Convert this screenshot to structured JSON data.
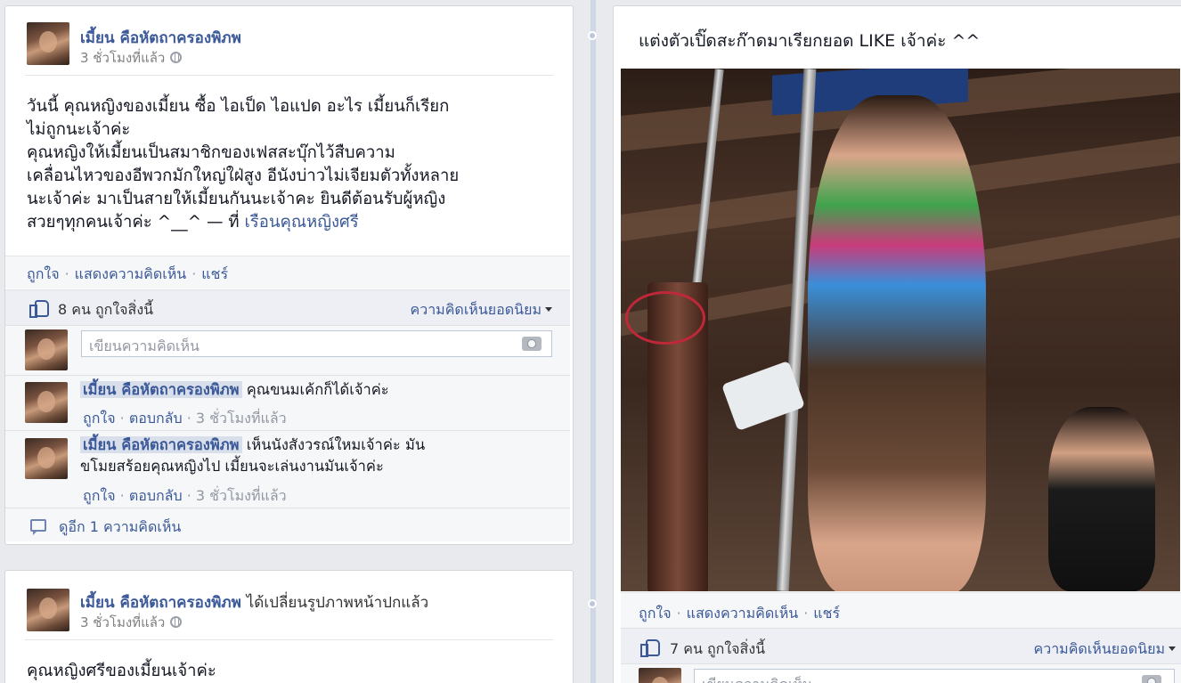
{
  "left_post_1": {
    "author": "เมี้ยน คือหัตถาครองพิภพ",
    "timestamp": "3 ชั่วโมงที่แล้ว",
    "text_lines": [
      "วันนี้ คุณหญิงของเมี้ยน ซื้อ ไอเป็ด ไอแปด อะไร เมี้ยนก็เรียก",
      "ไม่ถูกนะเจ้าค่ะ",
      "คุณหญิงให้เมี้ยนเป็นสมาชิกของเฟสสะบุ๊กไว้สืบความ",
      "เคลื่อนไหวของอีพวกมักใหญ่ใฝ่สูง อีนังบ่าวไม่เจียมตัวทั้งหลาย",
      "นะเจ้าค่ะ มาเป็นสายให้เมี้ยนกันนะเจ้าคะ ยินดีต้อนรับผู้หญิง"
    ],
    "text_last_line": "สวยๆทุกคนเจ้าค่ะ ^__^ — ที่ ",
    "place": "เรือนคุณหญิงศรี",
    "actions": {
      "like": "ถูกใจ",
      "comment": "แสดงความคิดเห็น",
      "share": "แชร์"
    },
    "likes_text": "8 คน ถูกใจสิ่งนี้",
    "top_comments": "ความคิดเห็นยอดนิยม",
    "comment_placeholder": "เขียนความคิดเห็น",
    "comments": [
      {
        "author": "เมี้ยน คือหัตถาครองพิภพ",
        "text": "คุณขนมเค้กก็ได้เจ้าค่ะ",
        "like": "ถูกใจ",
        "reply": "ตอบกลับ",
        "time": "3 ชั่วโมงที่แล้ว"
      },
      {
        "author": "เมี้ยน คือหัตถาครองพิภพ",
        "text": "เห็นนังสังวรณ์ใหมเจ้าค่ะ มัน",
        "text_line2": "ขโมยสร้อยคุณหญิงไป เมี้ยนจะเล่นงานมันเจ้าค่ะ",
        "like": "ถูกใจ",
        "reply": "ตอบกลับ",
        "time": "3 ชั่วโมงที่แล้ว"
      }
    ],
    "more_comments": "ดูอีก 1 ความคิดเห็น"
  },
  "left_post_2": {
    "author": "เมี้ยน คือหัตถาครองพิภพ",
    "action": "ได้เปลี่ยนรูปภาพหน้าปกแล้ว",
    "timestamp": "3 ชั่วโมงที่แล้ว",
    "text": "คุณหญิงศรีของเมี้ยนเจ้าค่ะ"
  },
  "right_post": {
    "caption": "แต่งตัวเปิ๊ดสะก๊าดมาเรียกยอด LIKE เจ้าค่ะ ^^",
    "actions": {
      "like": "ถูกใจ",
      "comment": "แสดงความคิดเห็น",
      "share": "แชร์"
    },
    "likes_text": "7 คน ถูกใจสิ่งนี้",
    "top_comments": "ความคิดเห็นยอดนิยม",
    "comment_placeholder": "เขียนความคิดเห็น"
  }
}
